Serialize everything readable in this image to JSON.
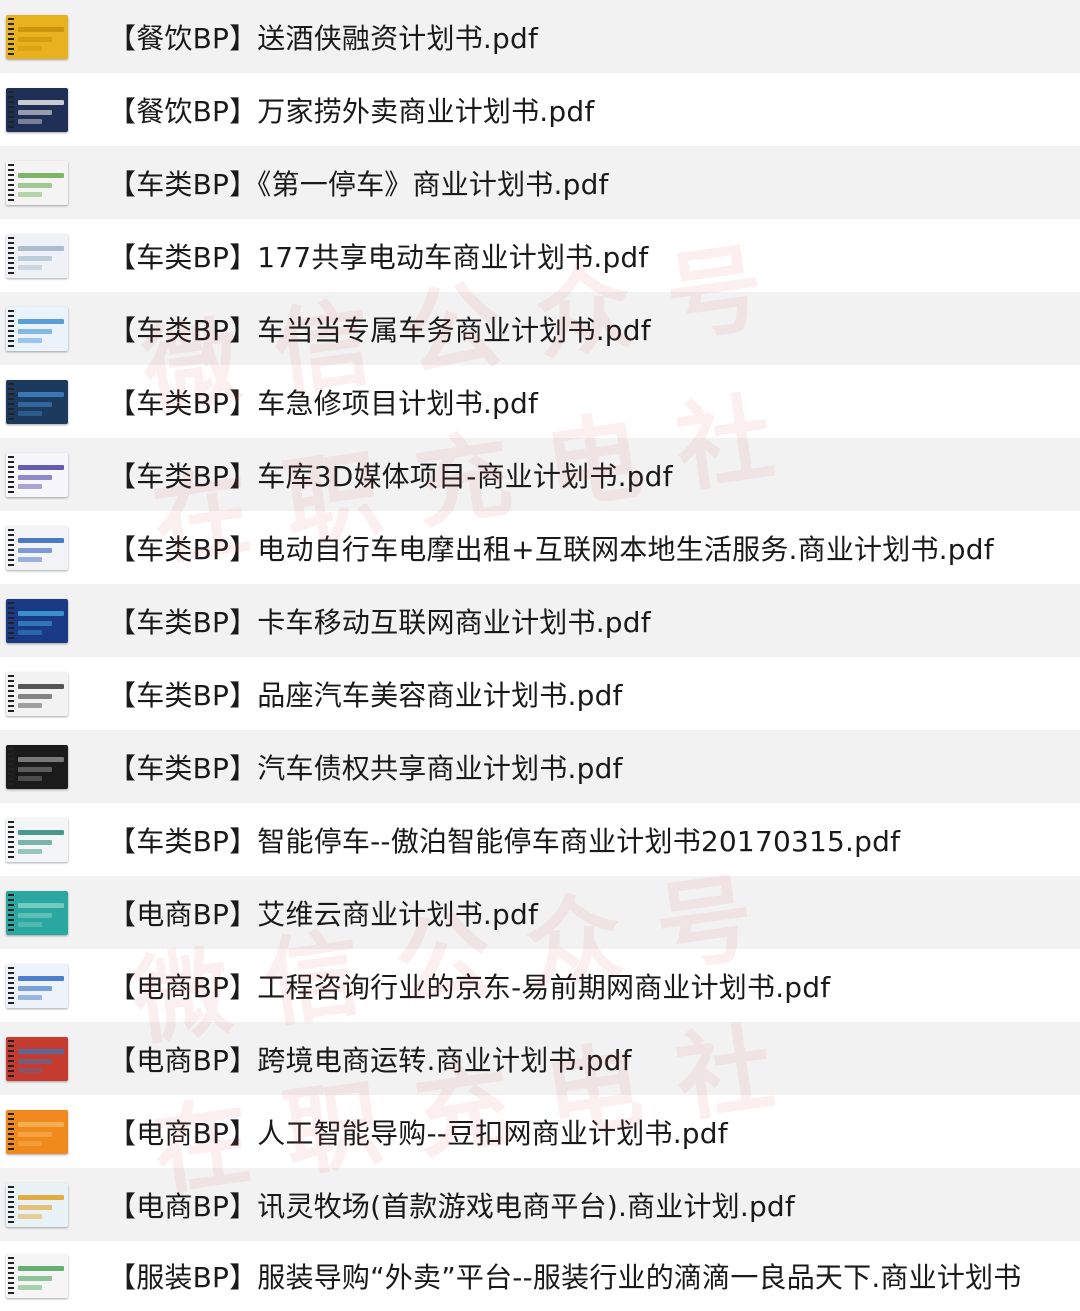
{
  "files": [
    {
      "name": "【餐饮BP】送酒侠融资计划书.pdf",
      "thumb_colors": [
        "#e8b21f",
        "#c98e0a"
      ]
    },
    {
      "name": "【餐饮BP】万家捞外卖商业计划书.pdf",
      "thumb_colors": [
        "#1f2f55",
        "#e6e6e6"
      ]
    },
    {
      "name": "【车类BP】《第一停车》商业计划书.pdf",
      "thumb_colors": [
        "#f4f4f4",
        "#6aa84f"
      ]
    },
    {
      "name": "【车类BP】177共享电动车商业计划书.pdf",
      "thumb_colors": [
        "#eef2f6",
        "#9fb4c8"
      ]
    },
    {
      "name": "【车类BP】车当当专属车务商业计划书.pdf",
      "thumb_colors": [
        "#eaf2fb",
        "#3f8fd2"
      ]
    },
    {
      "name": "【车类BP】车急修项目计划书.pdf",
      "thumb_colors": [
        "#1c3a5e",
        "#3f82c4"
      ]
    },
    {
      "name": "【车类BP】车库3D媒体项目-商业计划书.pdf",
      "thumb_colors": [
        "#f7f7fb",
        "#4a3fa8"
      ]
    },
    {
      "name": "【车类BP】电动自行车电摩出租+互联网本地生活服务.商业计划书.pdf",
      "thumb_colors": [
        "#f1f3f7",
        "#2e63b8"
      ]
    },
    {
      "name": "【车类BP】卡车移动互联网商业计划书.pdf",
      "thumb_colors": [
        "#1a3a86",
        "#3fa0d8"
      ]
    },
    {
      "name": "【车类BP】品座汽车美容商业计划书.pdf",
      "thumb_colors": [
        "#f2f2f2",
        "#3a3a3a"
      ]
    },
    {
      "name": "【车类BP】汽车债权共享商业计划书.pdf",
      "thumb_colors": [
        "#1b1b1b",
        "#8a8a8a"
      ]
    },
    {
      "name": "【车类BP】智能停车--傲泊智能停车商业计划书20170315.pdf",
      "thumb_colors": [
        "#f3f5f6",
        "#2a8a7a"
      ]
    },
    {
      "name": "【电商BP】艾维云商业计划书.pdf",
      "thumb_colors": [
        "#2aa7a0",
        "#7fd0c6"
      ]
    },
    {
      "name": "【电商BP】工程咨询行业的京东-易前期网商业计划书.pdf",
      "thumb_colors": [
        "#eef3fb",
        "#2f6ac4"
      ]
    },
    {
      "name": "【电商BP】跨境电商运转.商业计划书.pdf",
      "thumb_colors": [
        "#c63b2f",
        "#4a6fa8"
      ]
    },
    {
      "name": "【电商BP】人工智能导购--豆扣网商业计划书.pdf",
      "thumb_colors": [
        "#f08a1c",
        "#f5b45a"
      ]
    },
    {
      "name": "【电商BP】讯灵牧场(首款游戏电商平台).商业计划.pdf",
      "thumb_colors": [
        "#e8f2f7",
        "#e0a020"
      ]
    },
    {
      "name": "【服装BP】服装导购“外卖”平台--服装行业的滴滴一良品天下.商业计划书",
      "thumb_colors": [
        "#f5f5f5",
        "#4aa35a"
      ]
    }
  ],
  "watermark": {
    "line1": "微信公众号",
    "line2": "在职充电社"
  },
  "colors": {
    "row_alt": "#f2f2f2",
    "row_plain": "#ffffff",
    "text": "#1a1a1a"
  }
}
